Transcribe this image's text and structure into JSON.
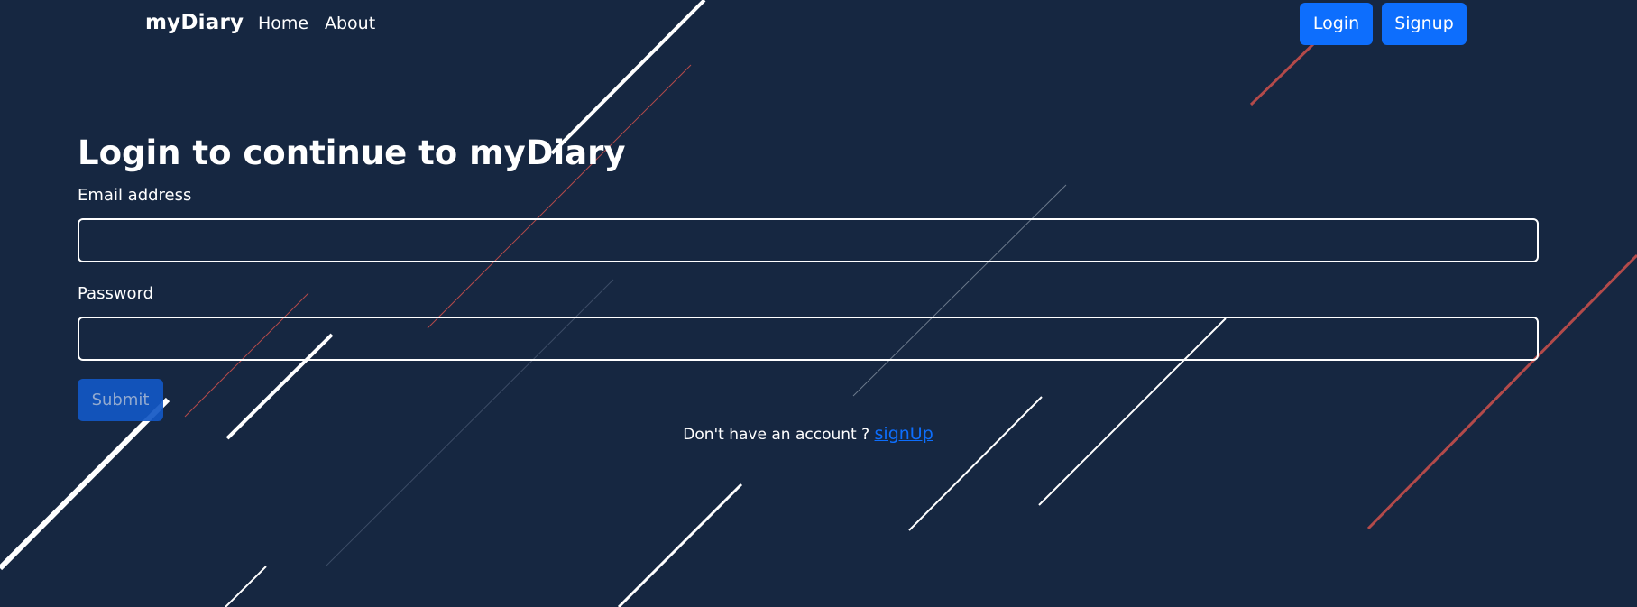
{
  "navbar": {
    "brand": "myDiary",
    "links": [
      {
        "label": "Home"
      },
      {
        "label": "About"
      }
    ],
    "login_label": "Login",
    "signup_label": "Signup"
  },
  "form": {
    "heading": "Login to continue to myDiary",
    "email_label": "Email address",
    "email_value": "",
    "password_label": "Password",
    "password_value": "",
    "submit_label": "Submit"
  },
  "footer_prompt": {
    "text": "Don't have an account ?",
    "link_label": "signUp"
  },
  "colors": {
    "background": "#162741",
    "accent": "#0d6efd",
    "submit_disabled": "#1257c5",
    "decor_white": "#ffffff",
    "decor_red": "#b34a4a"
  }
}
